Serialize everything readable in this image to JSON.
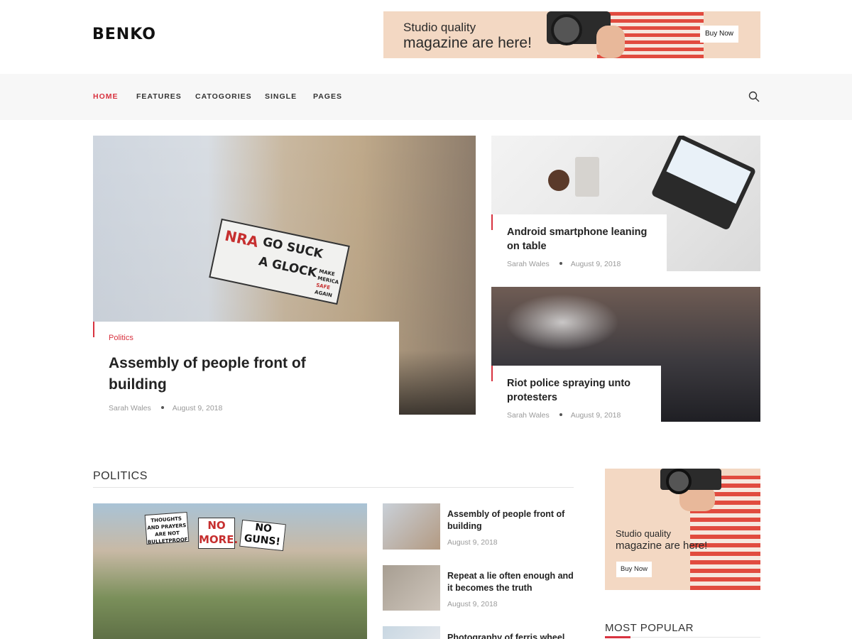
{
  "brand": {
    "logo_text": "BENKO"
  },
  "top_ad": {
    "line1": "Studio quality",
    "line2": "magazine are here!",
    "button": "Buy Now"
  },
  "nav": {
    "items": [
      {
        "label": "HOME",
        "active": true
      },
      {
        "label": "FEATURES",
        "active": false
      },
      {
        "label": "CATOGORIES",
        "active": false
      },
      {
        "label": "SINGLE",
        "active": false
      },
      {
        "label": "PAGES",
        "active": false
      }
    ],
    "search_icon": "search-icon"
  },
  "featured": {
    "main": {
      "category": "Politics",
      "title_l1": "Assembly of people front of",
      "title_l2": "building",
      "author": "Sarah Wales",
      "date": "August 9, 2018",
      "sign_words": [
        "NRA",
        "GO SUCK",
        "A GLOCK",
        "MAKE",
        "MERICA",
        "SAFE",
        "AGAIN"
      ]
    },
    "side1": {
      "title_l1": "Android smartphone leaning",
      "title_l2": "on table",
      "author": "Sarah Wales",
      "date": "August 9, 2018"
    },
    "side2": {
      "title_l1": "Riot police spraying unto",
      "title_l2": "protesters",
      "author": "Sarah Wales",
      "date": "August 9, 2018"
    }
  },
  "politics": {
    "heading": "POLITICS",
    "lead_image_signs": [
      "THOUGHTS AND PRAYERS ARE NOT BULLETPROOF",
      "NO MORE.",
      "NO GUNS!"
    ],
    "list": [
      {
        "title": "Assembly of people front of building",
        "date": "August 9, 2018"
      },
      {
        "title": "Repeat a lie often enough and it becomes the truth",
        "date": "August 9, 2018"
      },
      {
        "title": "Photography of ferris wheel",
        "date": ""
      }
    ]
  },
  "sidebar": {
    "ad": {
      "line1": "Studio quality",
      "line2": "magazine are here!",
      "button": "Buy Now"
    },
    "most_popular": "MOST POPULAR"
  },
  "colors": {
    "accent": "#d8323f",
    "ad_bg": "#f3d8c3",
    "nav_bg": "#f7f7f7"
  }
}
